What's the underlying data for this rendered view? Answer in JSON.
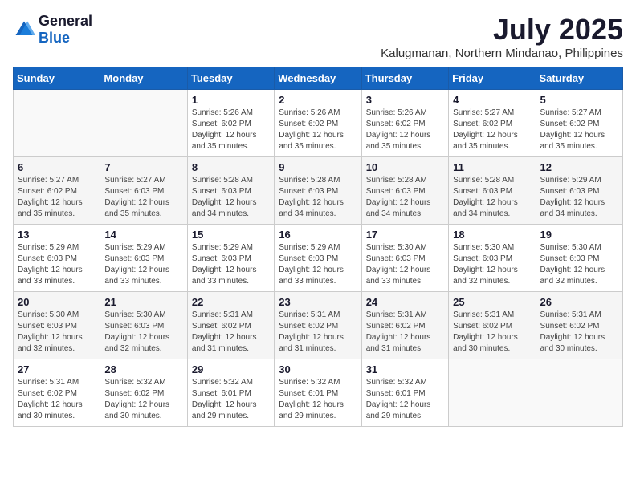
{
  "header": {
    "logo_general": "General",
    "logo_blue": "Blue",
    "main_title": "July 2025",
    "subtitle": "Kalugmanan, Northern Mindanao, Philippines"
  },
  "weekdays": [
    "Sunday",
    "Monday",
    "Tuesday",
    "Wednesday",
    "Thursday",
    "Friday",
    "Saturday"
  ],
  "weeks": [
    [
      {
        "day": "",
        "info": ""
      },
      {
        "day": "",
        "info": ""
      },
      {
        "day": "1",
        "info": "Sunrise: 5:26 AM\nSunset: 6:02 PM\nDaylight: 12 hours and 35 minutes."
      },
      {
        "day": "2",
        "info": "Sunrise: 5:26 AM\nSunset: 6:02 PM\nDaylight: 12 hours and 35 minutes."
      },
      {
        "day": "3",
        "info": "Sunrise: 5:26 AM\nSunset: 6:02 PM\nDaylight: 12 hours and 35 minutes."
      },
      {
        "day": "4",
        "info": "Sunrise: 5:27 AM\nSunset: 6:02 PM\nDaylight: 12 hours and 35 minutes."
      },
      {
        "day": "5",
        "info": "Sunrise: 5:27 AM\nSunset: 6:02 PM\nDaylight: 12 hours and 35 minutes."
      }
    ],
    [
      {
        "day": "6",
        "info": "Sunrise: 5:27 AM\nSunset: 6:02 PM\nDaylight: 12 hours and 35 minutes."
      },
      {
        "day": "7",
        "info": "Sunrise: 5:27 AM\nSunset: 6:03 PM\nDaylight: 12 hours and 35 minutes."
      },
      {
        "day": "8",
        "info": "Sunrise: 5:28 AM\nSunset: 6:03 PM\nDaylight: 12 hours and 34 minutes."
      },
      {
        "day": "9",
        "info": "Sunrise: 5:28 AM\nSunset: 6:03 PM\nDaylight: 12 hours and 34 minutes."
      },
      {
        "day": "10",
        "info": "Sunrise: 5:28 AM\nSunset: 6:03 PM\nDaylight: 12 hours and 34 minutes."
      },
      {
        "day": "11",
        "info": "Sunrise: 5:28 AM\nSunset: 6:03 PM\nDaylight: 12 hours and 34 minutes."
      },
      {
        "day": "12",
        "info": "Sunrise: 5:29 AM\nSunset: 6:03 PM\nDaylight: 12 hours and 34 minutes."
      }
    ],
    [
      {
        "day": "13",
        "info": "Sunrise: 5:29 AM\nSunset: 6:03 PM\nDaylight: 12 hours and 33 minutes."
      },
      {
        "day": "14",
        "info": "Sunrise: 5:29 AM\nSunset: 6:03 PM\nDaylight: 12 hours and 33 minutes."
      },
      {
        "day": "15",
        "info": "Sunrise: 5:29 AM\nSunset: 6:03 PM\nDaylight: 12 hours and 33 minutes."
      },
      {
        "day": "16",
        "info": "Sunrise: 5:29 AM\nSunset: 6:03 PM\nDaylight: 12 hours and 33 minutes."
      },
      {
        "day": "17",
        "info": "Sunrise: 5:30 AM\nSunset: 6:03 PM\nDaylight: 12 hours and 33 minutes."
      },
      {
        "day": "18",
        "info": "Sunrise: 5:30 AM\nSunset: 6:03 PM\nDaylight: 12 hours and 32 minutes."
      },
      {
        "day": "19",
        "info": "Sunrise: 5:30 AM\nSunset: 6:03 PM\nDaylight: 12 hours and 32 minutes."
      }
    ],
    [
      {
        "day": "20",
        "info": "Sunrise: 5:30 AM\nSunset: 6:03 PM\nDaylight: 12 hours and 32 minutes."
      },
      {
        "day": "21",
        "info": "Sunrise: 5:30 AM\nSunset: 6:03 PM\nDaylight: 12 hours and 32 minutes."
      },
      {
        "day": "22",
        "info": "Sunrise: 5:31 AM\nSunset: 6:02 PM\nDaylight: 12 hours and 31 minutes."
      },
      {
        "day": "23",
        "info": "Sunrise: 5:31 AM\nSunset: 6:02 PM\nDaylight: 12 hours and 31 minutes."
      },
      {
        "day": "24",
        "info": "Sunrise: 5:31 AM\nSunset: 6:02 PM\nDaylight: 12 hours and 31 minutes."
      },
      {
        "day": "25",
        "info": "Sunrise: 5:31 AM\nSunset: 6:02 PM\nDaylight: 12 hours and 30 minutes."
      },
      {
        "day": "26",
        "info": "Sunrise: 5:31 AM\nSunset: 6:02 PM\nDaylight: 12 hours and 30 minutes."
      }
    ],
    [
      {
        "day": "27",
        "info": "Sunrise: 5:31 AM\nSunset: 6:02 PM\nDaylight: 12 hours and 30 minutes."
      },
      {
        "day": "28",
        "info": "Sunrise: 5:32 AM\nSunset: 6:02 PM\nDaylight: 12 hours and 30 minutes."
      },
      {
        "day": "29",
        "info": "Sunrise: 5:32 AM\nSunset: 6:01 PM\nDaylight: 12 hours and 29 minutes."
      },
      {
        "day": "30",
        "info": "Sunrise: 5:32 AM\nSunset: 6:01 PM\nDaylight: 12 hours and 29 minutes."
      },
      {
        "day": "31",
        "info": "Sunrise: 5:32 AM\nSunset: 6:01 PM\nDaylight: 12 hours and 29 minutes."
      },
      {
        "day": "",
        "info": ""
      },
      {
        "day": "",
        "info": ""
      }
    ]
  ]
}
